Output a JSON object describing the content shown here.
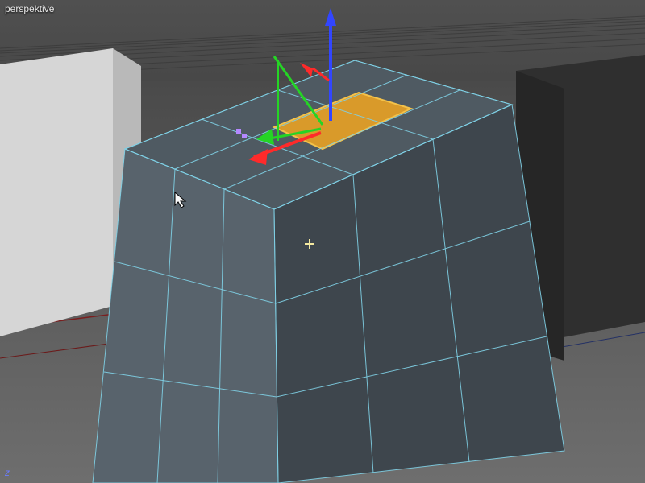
{
  "viewport": {
    "title": "perspektive",
    "axis_label_z": "z",
    "crosshair_glyph": "+",
    "cursor_glyph": "↖"
  },
  "gizmo": {
    "x_color": "#ff2a2a",
    "y_color": "#25d425",
    "z_color": "#3246ff"
  },
  "selection": {
    "face_color": "#d99a2a",
    "wire_color": "#7fd0e6"
  },
  "scene": {
    "ground_near": "#6e6e6e",
    "ground_far": "#4a4a4a",
    "bg_cube_left": "#cfcfcf",
    "bg_cube_right": "#2f2f2f",
    "main_top": "#4f5a62",
    "main_front": "#58636c",
    "main_side": "#3e464d"
  }
}
